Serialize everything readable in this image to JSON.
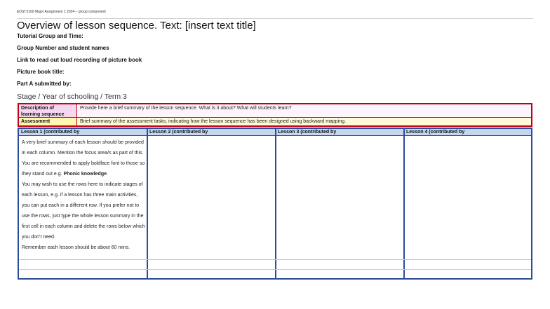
{
  "header_note": "EDST3100 Major Assignment 1 2024 – group component",
  "title": "Overview of lesson sequence. Text: [insert text title]",
  "fields": [
    "Tutorial Group and Time:",
    "Group Number and student names",
    "Link to read out loud recording of picture book",
    "Picture book title:",
    "Part A submitted by:"
  ],
  "stage_line": "Stage / Year of schooling / Term 3",
  "summary": {
    "rows": [
      {
        "label": "Description of learning sequence",
        "text": "Provide here a brief summary of the lesson sequence. What is it about? What will students learn?"
      },
      {
        "label": "Assessment",
        "text": "Brief summary of the assessment tasks, indicating how the lesson sequence has been designed using backward mapping."
      }
    ]
  },
  "lessons": {
    "headers": [
      "Lesson 1 (contributed by",
      "Lesson 2 (contributed by",
      "Lesson 3 (contributed by",
      "Lesson 4 (contributed by"
    ],
    "instructions": {
      "p1_before": "A very brief summary of each lesson should be provided in each column. Mention the focus area/s as part of this. You are recommended to apply boldface font to those so they stand out e.g. ",
      "p1_bold": "Phonic knowledge",
      "p1_after": ".",
      "p2": "You may wish to use the rows here to indicate stages of each lesson, e.g. if a lesson has three main activities, you can put each in a different row. If you prefer not to use the rows, just type the whole lesson summary in the first cell in each column and delete the rows below which you don’t need.",
      "p3": "Remember each lesson should be about 60 mins."
    }
  },
  "colors": {
    "summary_border": "#c00018",
    "lessons_border": "#2b4c9b",
    "lessons_header_fill": "#c7d5f1",
    "description_fill": "#f6d7f0",
    "assessment_fill": "#fff6b0"
  }
}
